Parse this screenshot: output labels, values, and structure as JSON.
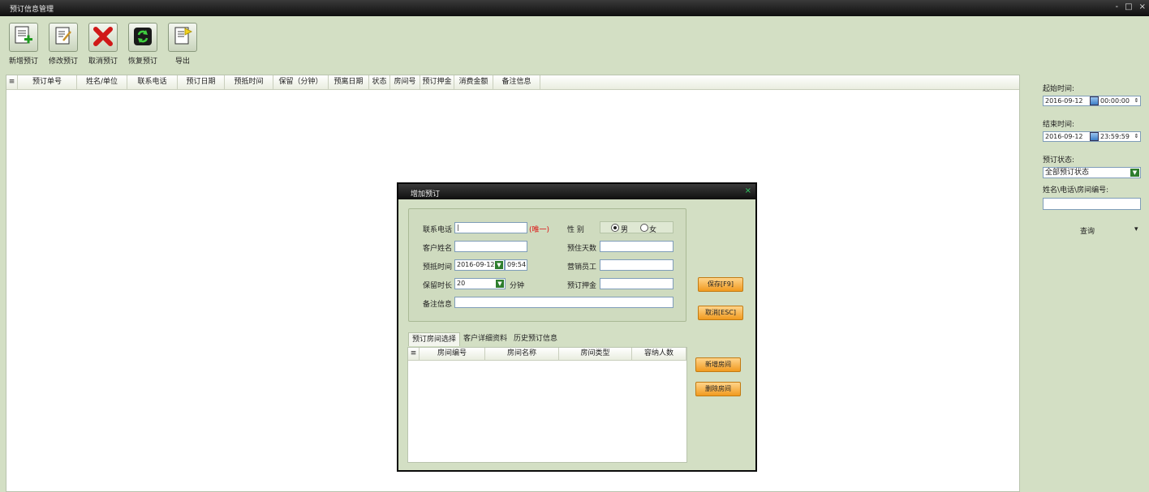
{
  "window": {
    "title": "预订信息管理",
    "controls": [
      "-",
      "□",
      "×"
    ]
  },
  "toolbar": {
    "buttons": [
      {
        "label": "新增预订",
        "icon": "add-document-icon"
      },
      {
        "label": "修改预订",
        "icon": "edit-document-icon"
      },
      {
        "label": "取消预订",
        "icon": "red-x-icon"
      },
      {
        "label": "恢复预订",
        "icon": "restore-icon"
      },
      {
        "label": "导出",
        "icon": "export-icon"
      }
    ]
  },
  "grid": {
    "menu_icon": "≡",
    "columns": [
      "预订单号",
      "姓名/单位",
      "联系电话",
      "预订日期",
      "预抵时间",
      "保留（分钟）",
      "预离日期",
      "状态",
      "房间号",
      "预订押金",
      "消费金额",
      "备注信息"
    ]
  },
  "sidebar": {
    "start_label": "起始时间:",
    "start_date": "2016-09-12",
    "start_time": "00:00:00",
    "end_label": "结束时间:",
    "end_date": "2016-09-12",
    "end_time": "23:59:59",
    "status_label": "预订状态:",
    "status_value": "全部预订状态",
    "search_label": "姓名\\电话\\房间编号:",
    "search_value": "",
    "query_label": "查询",
    "query_arrow": "▾"
  },
  "dialog": {
    "title": "增加预订",
    "close": "×",
    "phone_label": "联系电话",
    "phone_value": "|",
    "unique_note": "(唯一)",
    "gender_label": "性  别",
    "gender_male": "男",
    "gender_female": "女",
    "gender_selected": "男",
    "name_label": "客户姓名",
    "name_value": "",
    "days_label": "预住天数",
    "days_value": "",
    "arrive_label": "预抵时间",
    "arrive_date": "2016-09-12",
    "arrive_time": "09:54",
    "staff_label": "营销员工",
    "staff_value": "",
    "keep_label": "保留时长",
    "keep_value": "20",
    "keep_unit": "分钟",
    "deposit_label": "预订押金",
    "deposit_value": "",
    "remark_label": "备注信息",
    "remark_value": "",
    "save_label": "保存[F9]",
    "cancel_label": "取消[ESC]",
    "tabs": [
      "预订房间选择",
      "客户详细资料",
      "历史预订信息"
    ],
    "room_columns": [
      "房间编号",
      "房间名称",
      "房间类型",
      "容纳人数"
    ],
    "add_room_label": "新增房间",
    "delete_room_label": "删除房间"
  }
}
